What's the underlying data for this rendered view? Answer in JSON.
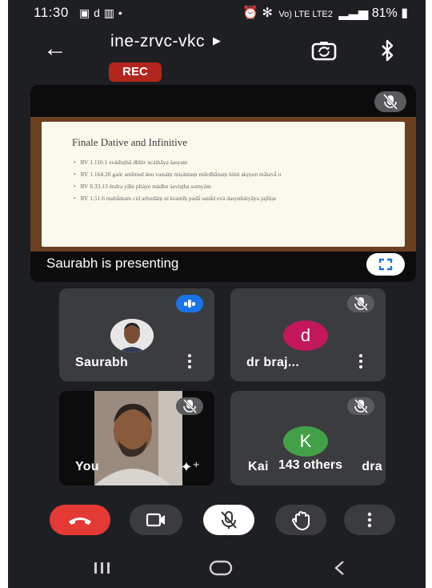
{
  "status_bar": {
    "time": "11:30",
    "notification_icons": "▣ d ▥ •",
    "signal_text": "Vo) LTE\nLTE2",
    "battery": "81%"
  },
  "header": {
    "meeting_code": "ine-zrvc-vkc",
    "recording_badge": "REC"
  },
  "presentation": {
    "slide_title": "Finale Dative and Infinitive",
    "slide_bullets": [
      "RV 1.110.1 svádiṣṭhā dhītir ucáthāya śasyate",
      "RV 1.164.28 gaúr amīmed ánu vatsáṃ miṣántaṃ mūrdhā́naṃ híṅṅ akṛṇon mā́tavā́ u",
      "RV 8.33.13 éndra yāhi pītáye mádhu śaviṣṭha somyám",
      "RV 1.51.6 mahā́ntam cid arbudáṃ ni kramīḥ padā́ sanā́d evá dasyuhátyāya jajñiṣe"
    ],
    "presenter_text": "Saurabh is presenting"
  },
  "participants": [
    {
      "name": "Saurabh",
      "status": "speaking"
    },
    {
      "name": "dr braj...",
      "initial": "d",
      "avatar_color": "#c2185b",
      "status": "muted"
    },
    {
      "name": "You",
      "status": "muted"
    },
    {
      "name": "Kai",
      "name_tail": "dra",
      "initial": "K",
      "avatar_color": "#43a047",
      "overflow_label": "143 others",
      "status": "muted"
    }
  ],
  "colors": {
    "end_call": "#e53935",
    "rec": "#b3261e",
    "speaking": "#1a73e8",
    "tile_bg": "#3b3c3f"
  },
  "icons": {
    "controls": [
      "end-call-icon",
      "camera-icon",
      "mic-off-icon",
      "raise-hand-icon",
      "more-options-icon"
    ],
    "nav": [
      "recents-icon",
      "home-icon",
      "back-icon"
    ]
  }
}
